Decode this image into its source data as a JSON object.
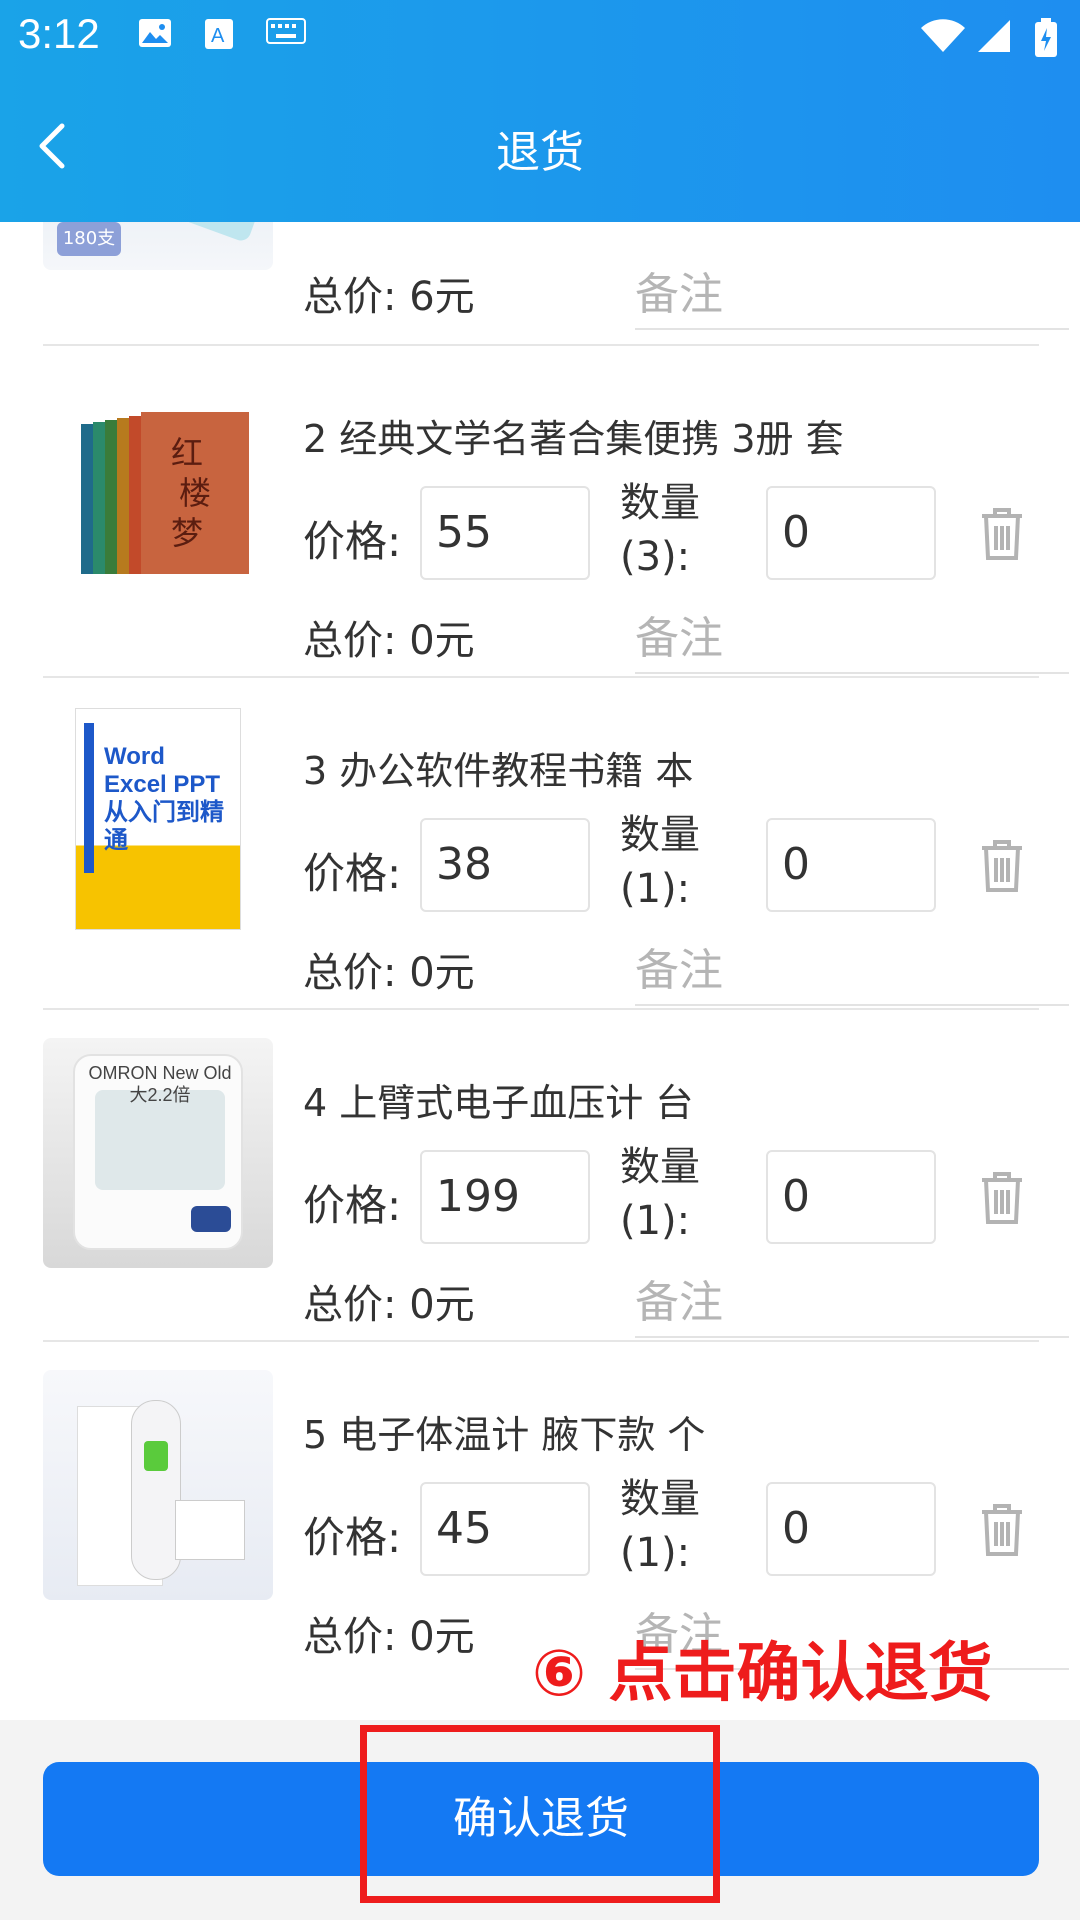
{
  "status_bar": {
    "time": "3:12"
  },
  "header": {
    "title": "退货"
  },
  "partial_item": {
    "total": "总价: 6元",
    "note_placeholder": "备注",
    "image_caption": "180支"
  },
  "items": [
    {
      "name": "2 经典文学名著合集便携 3册 套",
      "price_label": "价格:",
      "price": "55",
      "qty_label": "数量\n(3):",
      "qty": "0",
      "total": "总价: 0元",
      "note_placeholder": "备注",
      "image_text": "红楼梦"
    },
    {
      "name": "3 办公软件教程书籍   本",
      "price_label": "价格:",
      "price": "38",
      "qty_label": "数量\n(1):",
      "qty": "0",
      "total": "总价: 0元",
      "note_placeholder": "备注",
      "image_text": "Word Excel PPT 从入门到精通"
    },
    {
      "name": "4 上臂式电子血压计   台",
      "price_label": "价格:",
      "price": "199",
      "qty_label": "数量\n(1):",
      "qty": "0",
      "total": "总价: 0元",
      "note_placeholder": "备注",
      "image_text": "OMRON New Old 大2.2倍"
    },
    {
      "name": "5 电子体温计 腋下款  个",
      "price_label": "价格:",
      "price": "45",
      "qty_label": "数量\n(1):",
      "qty": "0",
      "total": "总价: 0元",
      "note_placeholder": "备注",
      "image_text": ""
    }
  ],
  "footer": {
    "confirm_label": "确认退货"
  },
  "annotation": {
    "text": "⑥ 点击确认退货"
  },
  "colors": {
    "header": "#1e8ef0",
    "confirm": "#1479f3",
    "annotation": "#ee1c1c"
  }
}
